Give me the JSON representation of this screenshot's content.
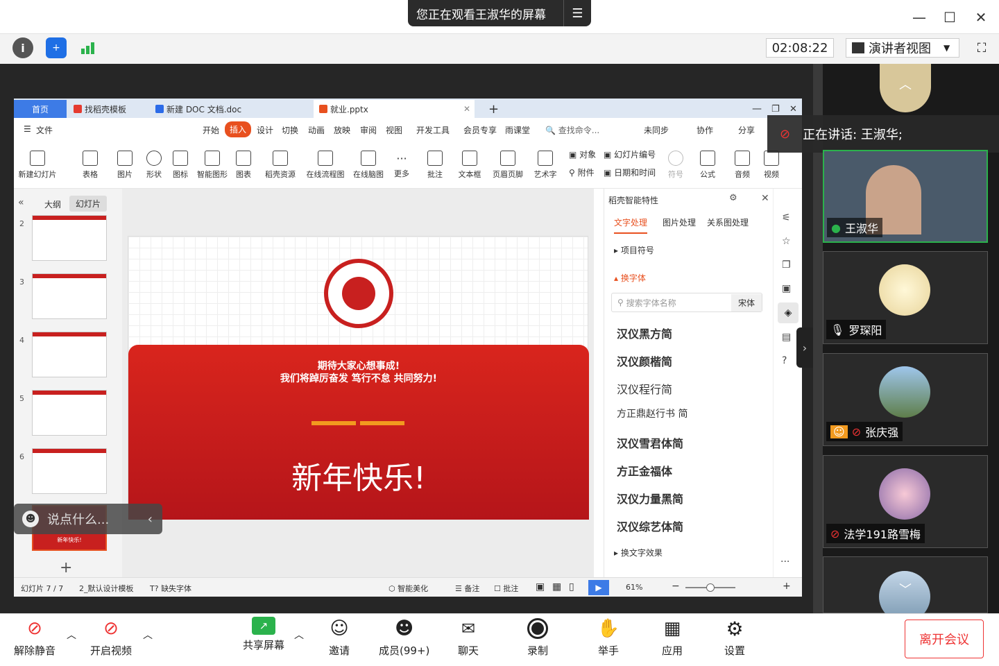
{
  "window": {
    "share_banner": "您正在观看王淑华的屏幕",
    "minimize": "—",
    "maximize": "☐",
    "close": "✕"
  },
  "toolbar": {
    "timer": "02:08:22",
    "view_label": "演讲者视图"
  },
  "app": {
    "tabs": [
      {
        "label": "首页"
      },
      {
        "label": "找稻壳模板"
      },
      {
        "label": "新建 DOC 文档.doc"
      },
      {
        "label": "就业.pptx"
      }
    ],
    "menu": [
      "文件",
      "开始",
      "插入",
      "设计",
      "切换",
      "动画",
      "放映",
      "审阅",
      "视图",
      "开发工具",
      "会员专享",
      "雨课堂"
    ],
    "search_placeholder": "查找命令...",
    "menu_right": [
      "未同步",
      "协作",
      "分享"
    ],
    "ribbon": [
      "新建幻灯片",
      "表格",
      "图片",
      "形状",
      "图标",
      "智能图形",
      "图表",
      "稻壳资源",
      "在线流程图",
      "在线脑图",
      "更多",
      "批注",
      "文本框",
      "页眉页脚",
      "艺术字",
      "对象",
      "附件",
      "幻灯片编号",
      "日期和时间",
      "符号",
      "公式",
      "音频",
      "视频"
    ],
    "pane_tabs": [
      "大纲",
      "幻灯片"
    ],
    "slide_numbers": [
      "2",
      "3",
      "4",
      "5",
      "6"
    ],
    "last_thumb_text": "新年快乐!",
    "slide": {
      "line1": "期待大家心想事成!",
      "line2": "我们将踔厉奋发 笃行不怠 共同努力!",
      "greeting": "新年快乐!"
    },
    "rightpane": {
      "title": "稻壳智能特性",
      "tabs": [
        "文字处理",
        "图片处理",
        "关系图处理"
      ],
      "section1": "项目符号",
      "section2": "换字体",
      "font_search_placeholder": "搜索字体名称",
      "current_font": "宋体",
      "fonts": [
        "汉仪黑方简",
        "汉仪颜楷简",
        "汉仪程行简",
        "方正鼎赵行书 简",
        "汉仪雪君体简",
        "方正金福体",
        "汉仪力量黑简",
        "汉仪综艺体简"
      ],
      "section3": "换文字效果"
    },
    "status": {
      "slide_count": "幻灯片 7 / 7",
      "template": "2_默认设计模板",
      "missing_font": "缺失字体",
      "beautify": "智能美化",
      "notes": "备注",
      "comments": "批注",
      "zoom": "61%"
    }
  },
  "chat": {
    "placeholder": "说点什么..."
  },
  "speaker": {
    "label": "正在讲话: 王淑华;"
  },
  "participants": [
    {
      "name": "王淑华"
    },
    {
      "name": "罗琛阳"
    },
    {
      "name": "张庆强"
    },
    {
      "name": "法学191路雪梅"
    }
  ],
  "bottom": {
    "buttons": [
      "解除静音",
      "开启视频",
      "共享屏幕",
      "邀请",
      "成员(99+)",
      "聊天",
      "录制",
      "举手",
      "应用",
      "设置"
    ],
    "leave": "离开会议"
  },
  "colors": {
    "accent": "#e8501f",
    "red": "#c8201f"
  }
}
